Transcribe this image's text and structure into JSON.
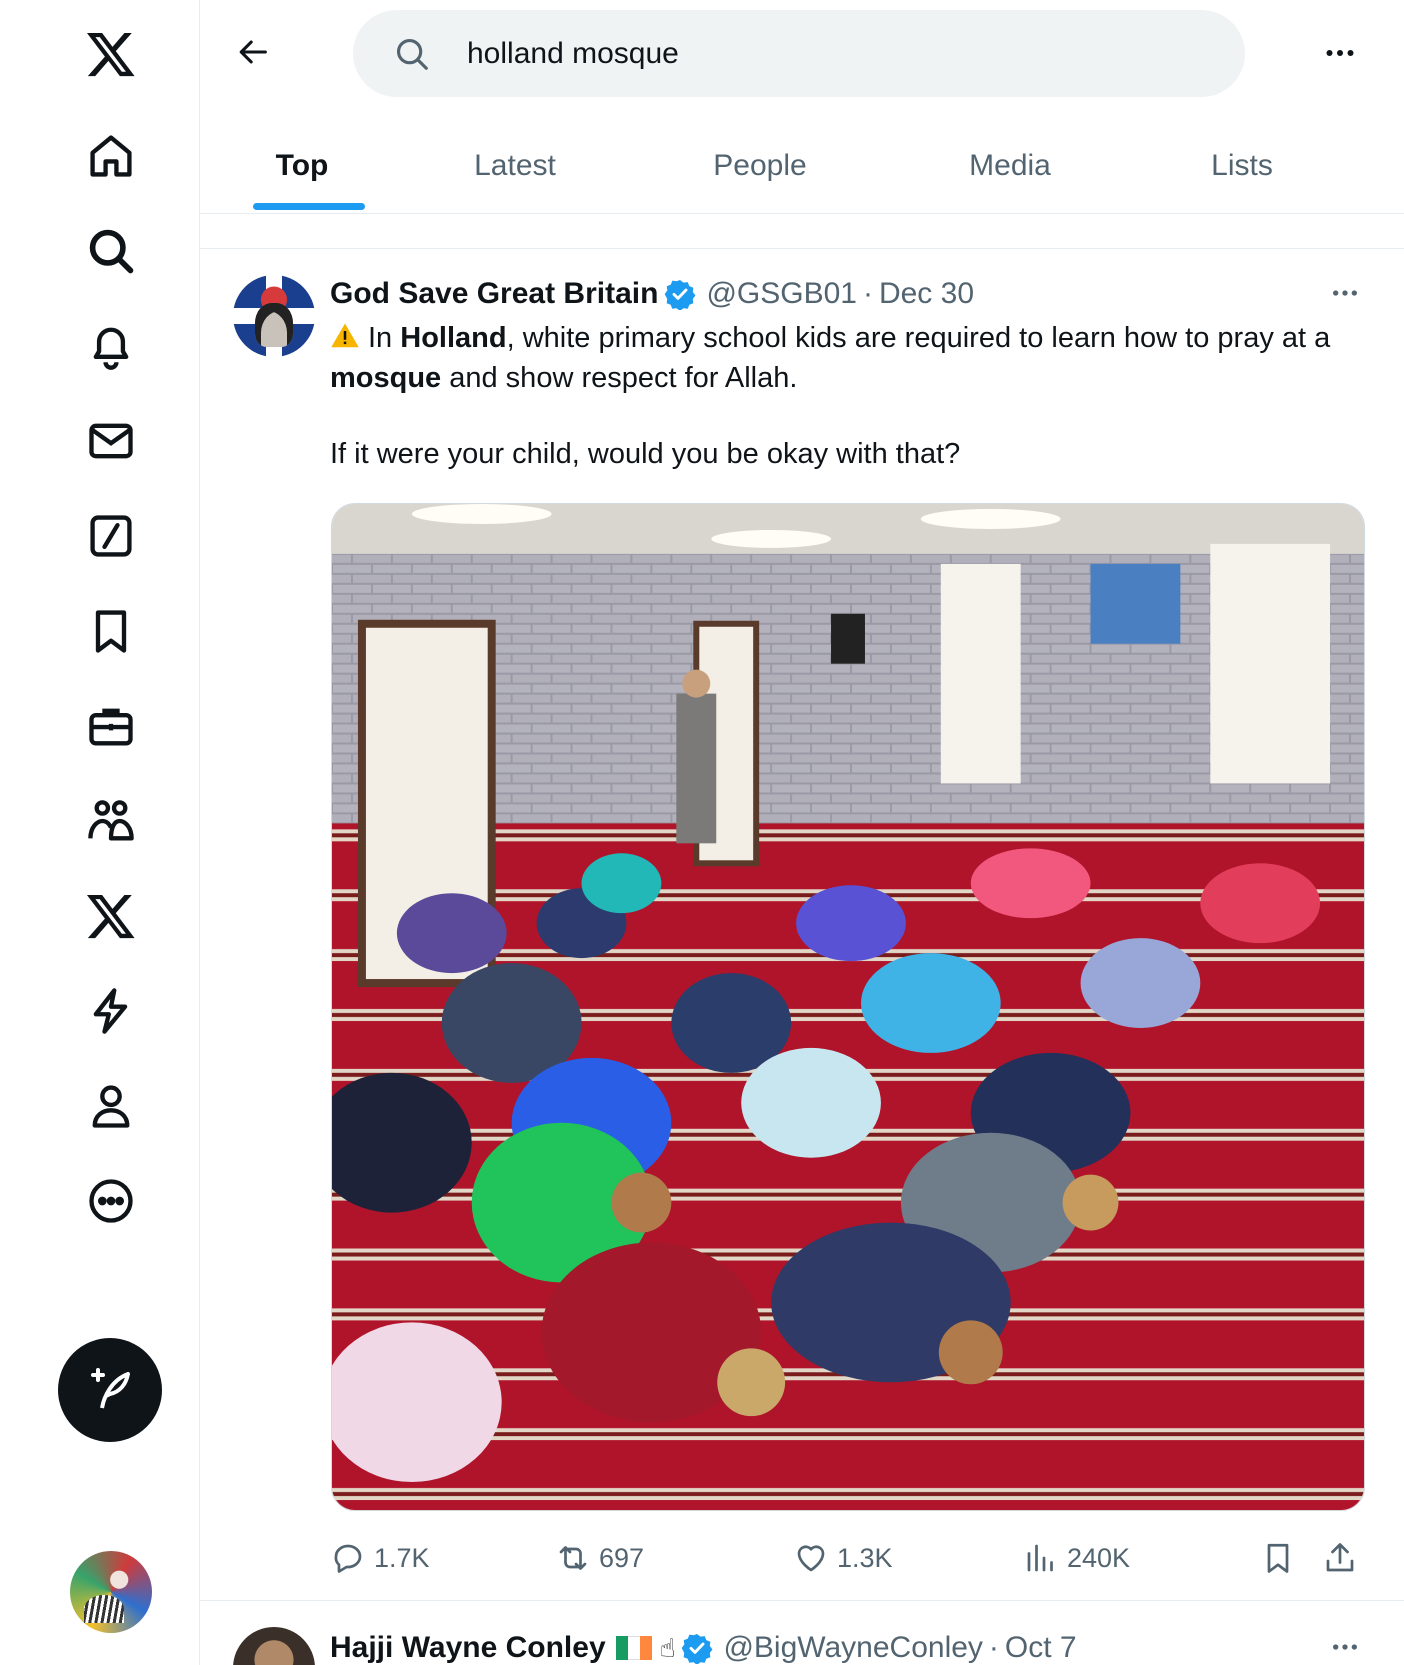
{
  "search": {
    "query": "holland mosque"
  },
  "tabs": [
    {
      "label": "Top",
      "active": true
    },
    {
      "label": "Latest"
    },
    {
      "label": "People"
    },
    {
      "label": "Media"
    },
    {
      "label": "Lists"
    }
  ],
  "nav": {
    "items": [
      "x-logo-icon",
      "home-icon",
      "explore-icon",
      "notifications-icon",
      "messages-icon",
      "grok-icon",
      "bookmarks-icon",
      "jobs-icon",
      "communities-icon",
      "premium-icon",
      "verified-orgs-icon",
      "profile-icon",
      "more-icon"
    ],
    "post_icon": "compose-post-icon"
  },
  "tweet": {
    "author": "God Save Great Britain",
    "handle": "@GSGB01",
    "date": "Dec 30",
    "text_parts": {
      "p1": "In ",
      "b1": "Holland",
      "p2": ", white primary school kids are required to learn how to pray at a ",
      "b2": "mosque",
      "p3": " and show respect for Allah.",
      "line2": "If it were your child, would you be okay with that?"
    },
    "replies": "1.7K",
    "retweets": "697",
    "likes": "1.3K",
    "views": "240K"
  },
  "next_tweet": {
    "author": "Hajji Wayne Conley",
    "handle": "@BigWayneConley",
    "date": "Oct 7"
  },
  "colors": {
    "accent": "#1d9bf0",
    "text": "#0f1419",
    "muted": "#536471",
    "verified": "#1d9bf0"
  }
}
